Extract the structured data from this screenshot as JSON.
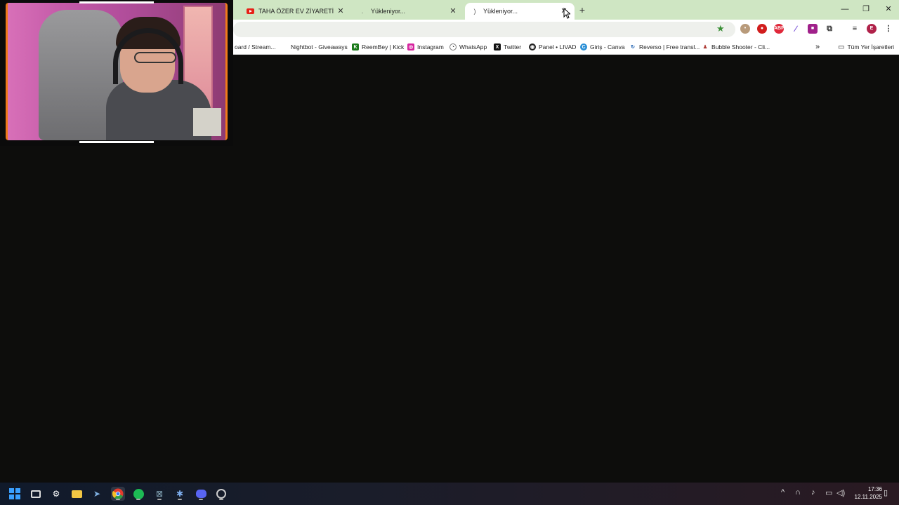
{
  "browser": {
    "tabs": [
      {
        "title": "TAHA ÖZER EV ZİYARETİ - YouTube",
        "favicon": "youtube-icon",
        "active": false
      },
      {
        "title": "Yükleniyor...",
        "favicon": "loading-icon",
        "active": false
      },
      {
        "title": "Yükleniyor...",
        "favicon": "loading-icon",
        "active": true
      }
    ],
    "new_tab": "+",
    "window_controls": {
      "minimize": "—",
      "maximize": "❐",
      "close": "✕"
    },
    "bookmarks": [
      {
        "label": "oard / Stream...",
        "icon": "bookmark-icon"
      },
      {
        "label": "Nightbot - Giveaways",
        "icon": "nightbot-icon"
      },
      {
        "label": "ReemBey | Kick",
        "icon": "kick-icon"
      },
      {
        "label": "Instagram",
        "icon": "instagram-icon"
      },
      {
        "label": "WhatsApp",
        "icon": "whatsapp-icon"
      },
      {
        "label": "Twitter",
        "icon": "x-icon"
      },
      {
        "label": "Panel • LIVAD",
        "icon": "livad-icon"
      },
      {
        "label": "Giriş - Canva",
        "icon": "canva-icon"
      },
      {
        "label": "Reverso | Free transl...",
        "icon": "reverso-icon"
      },
      {
        "label": "Bubble Shooter - Cli...",
        "icon": "bubble-icon"
      }
    ],
    "bookmarks_overflow": "»",
    "all_bookmarks": "Tüm Yer İşaretleri",
    "profile_initial": "E",
    "colors": {
      "tabstrip": "#cfe6c3",
      "page_bg": "#0d0d0c",
      "accent_green": "#3a8f36"
    }
  },
  "taskbar": {
    "time": "17:36",
    "date": "12.11.2025",
    "apps": [
      "windows-start-icon",
      "task-view-icon",
      "settings-icon",
      "file-explorer-icon",
      "steam-icon",
      "chrome-icon",
      "spotify-icon",
      "excel-icon",
      "app-gear-icon",
      "discord-icon",
      "obs-icon"
    ]
  }
}
